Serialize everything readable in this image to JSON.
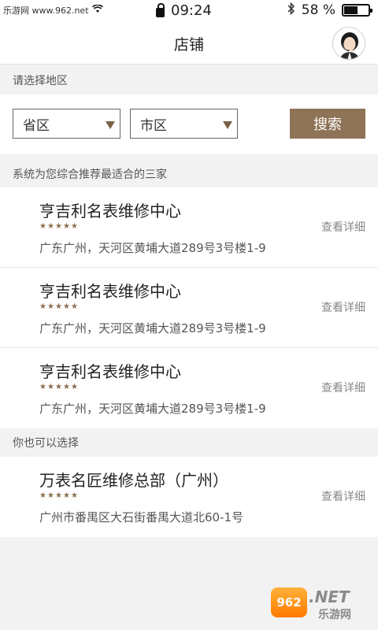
{
  "status_bar": {
    "watermark_text": "乐游网 www.962.net",
    "time": "09:24",
    "battery": "58 %",
    "battery_level": 0.58
  },
  "header": {
    "title": "店铺"
  },
  "region": {
    "heading": "请选择地区",
    "province_placeholder": "省区",
    "city_placeholder": "市区",
    "search_label": "搜索"
  },
  "recommend": {
    "heading": "系统为您综合推荐最适合的三家",
    "items": [
      {
        "name": "亨吉利名表维修中心",
        "rating": 5,
        "address": "广东广州，天河区黄埔大道289号3号楼1-9",
        "detail_label": "查看详细"
      },
      {
        "name": "亨吉利名表维修中心",
        "rating": 5,
        "address": "广东广州，天河区黄埔大道289号3号楼1-9",
        "detail_label": "查看详细"
      },
      {
        "name": "亨吉利名表维修中心",
        "rating": 5,
        "address": "广东广州，天河区黄埔大道289号3号楼1-9",
        "detail_label": "查看详细"
      }
    ]
  },
  "alternative": {
    "heading": "你也可以选择",
    "items": [
      {
        "name": "万表名匠维修总部（广州）",
        "rating": 5,
        "address": "广州市番禺区大石街番禺大道北60-1号",
        "detail_label": "查看详细"
      }
    ]
  },
  "watermark": {
    "badge": "962",
    "brand": ".NET",
    "sub": "乐游网"
  },
  "colors": {
    "accent": "#8f7356",
    "star": "#8c6e4e",
    "background": "#f2f2f2"
  }
}
